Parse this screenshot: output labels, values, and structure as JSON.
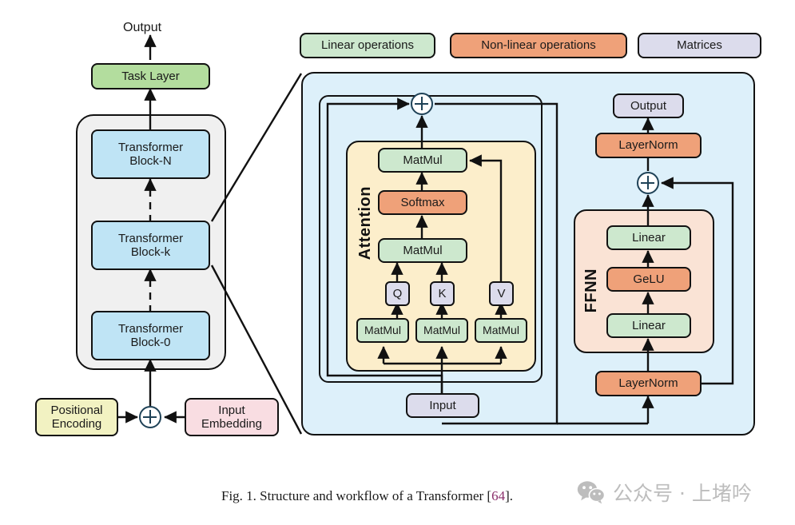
{
  "figure": {
    "caption_prefix": "Fig. 1.  Structure and workflow of a Transformer [",
    "caption_ref": "64",
    "caption_suffix": "]."
  },
  "watermark": {
    "text": "公众号 · 上堵吟",
    "icon": "wechat-icon"
  },
  "legend": {
    "items": [
      {
        "label": "Linear operations",
        "color": "#cde8ce"
      },
      {
        "label": "Non-linear operations",
        "color": "#efa179"
      },
      {
        "label": "Matrices",
        "color": "#dcdcec"
      }
    ]
  },
  "left_panel": {
    "output_label": "Output",
    "task_layer": {
      "label": "Task Layer",
      "color": "#b3dd9e"
    },
    "stack": {
      "color": "#f0f0f0",
      "blocks": [
        {
          "label": "Transformer\nBlock-N",
          "color": "#bfe4f5"
        },
        {
          "label": "Transformer\nBlock-k",
          "color": "#bfe4f5"
        },
        {
          "label": "Transformer\nBlock-0",
          "color": "#bfe4f5"
        }
      ]
    },
    "positional_encoding": {
      "label": "Positional\nEncoding",
      "color": "#f2f2c2"
    },
    "input_embedding": {
      "label": "Input\nEmbedding",
      "color": "#f9dde2"
    },
    "sum_operator": "plus-circle"
  },
  "detail_panel": {
    "color": "#ddf0fa",
    "attention": {
      "title": "Attention",
      "color": "#fceecb",
      "nodes": {
        "matmul_top": {
          "label": "MatMul",
          "color": "#cde8ce"
        },
        "softmax": {
          "label": "Softmax",
          "color": "#efa179"
        },
        "matmul_mid": {
          "label": "MatMul",
          "color": "#cde8ce"
        },
        "q": {
          "label": "Q",
          "color": "#dcdcec"
        },
        "k": {
          "label": "K",
          "color": "#dcdcec"
        },
        "v": {
          "label": "V",
          "color": "#dcdcec"
        },
        "matmul_q": {
          "label": "MatMul",
          "color": "#cde8ce"
        },
        "matmul_k": {
          "label": "MatMul",
          "color": "#cde8ce"
        },
        "matmul_v": {
          "label": "MatMul",
          "color": "#cde8ce"
        }
      }
    },
    "input": {
      "label": "Input",
      "color": "#dcdcec"
    },
    "ffnn": {
      "title": "FFNN",
      "color": "#fae3d5",
      "nodes": {
        "linear_top": {
          "label": "Linear",
          "color": "#cde8ce"
        },
        "gelu": {
          "label": "GeLU",
          "color": "#efa179"
        },
        "linear_bottom": {
          "label": "Linear",
          "color": "#cde8ce"
        }
      }
    },
    "layernorm_top": {
      "label": "LayerNorm",
      "color": "#efa179"
    },
    "layernorm_bottom": {
      "label": "LayerNorm",
      "color": "#efa179"
    },
    "output": {
      "label": "Output",
      "color": "#dcdcec"
    },
    "sum_operator_attention": "plus-circle",
    "sum_operator_ffnn": "plus-circle"
  }
}
